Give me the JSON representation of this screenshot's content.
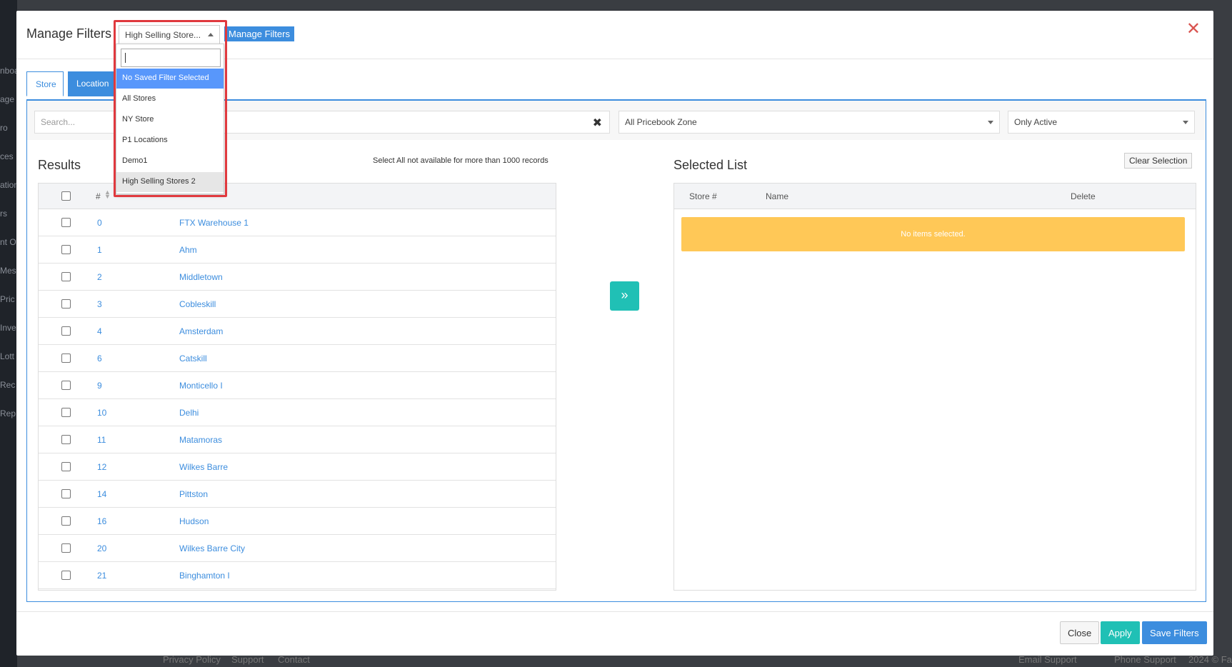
{
  "background": {
    "sidebar_fragments": [
      "nboa",
      "age",
      "ro",
      "ces",
      "ation",
      "rs",
      "nt Of",
      "Mes",
      "Pric",
      "Inve",
      "Lott",
      "Rec",
      "Rep"
    ],
    "footer_links": [
      "Privacy Policy",
      "Support",
      "Contact",
      "Email Support",
      "Phone Support",
      "2024 © Fa"
    ]
  },
  "header": {
    "title": "Manage Filters",
    "selected_filter": "High Selling Store...",
    "manage_button": "Manage Filters",
    "close_symbol": "✕"
  },
  "tabs": [
    {
      "label": "Store"
    },
    {
      "label": "Location"
    }
  ],
  "filters": {
    "search_placeholder": "Search...",
    "clear_symbol": "✖",
    "zone": "All Pricebook Zone",
    "status": "Only Active"
  },
  "results": {
    "title": "Results",
    "note": "Select All not available for more than 1000 records",
    "col_num": "#",
    "rows": [
      {
        "num": "0",
        "name": "FTX Warehouse 1"
      },
      {
        "num": "1",
        "name": "Ahm"
      },
      {
        "num": "2",
        "name": "Middletown"
      },
      {
        "num": "3",
        "name": "Cobleskill"
      },
      {
        "num": "4",
        "name": "Amsterdam"
      },
      {
        "num": "6",
        "name": "Catskill"
      },
      {
        "num": "9",
        "name": "Monticello I"
      },
      {
        "num": "10",
        "name": "Delhi"
      },
      {
        "num": "11",
        "name": "Matamoras"
      },
      {
        "num": "12",
        "name": "Wilkes Barre"
      },
      {
        "num": "14",
        "name": "Pittston"
      },
      {
        "num": "16",
        "name": "Hudson"
      },
      {
        "num": "20",
        "name": "Wilkes Barre City"
      },
      {
        "num": "21",
        "name": "Binghamton I"
      }
    ]
  },
  "move_symbol": "»",
  "selected": {
    "title": "Selected List",
    "clear_button": "Clear Selection",
    "columns": [
      "Store #",
      "Name",
      "Delete"
    ],
    "empty_message": "No items selected."
  },
  "footer": {
    "close": "Close",
    "apply": "Apply",
    "save": "Save Filters"
  },
  "dropdown": {
    "search_value": "",
    "items": [
      {
        "label": "No Saved Filter Selected",
        "state": "highlighted"
      },
      {
        "label": "All Stores",
        "state": ""
      },
      {
        "label": "NY Store",
        "state": ""
      },
      {
        "label": "P1 Locations",
        "state": ""
      },
      {
        "label": "Demo1",
        "state": ""
      },
      {
        "label": "High Selling Stores 2",
        "state": "current"
      }
    ]
  },
  "colors": {
    "primary": "#3c8dde",
    "teal": "#20c0b5",
    "warning": "#ffc857",
    "danger": "#e0393e"
  }
}
